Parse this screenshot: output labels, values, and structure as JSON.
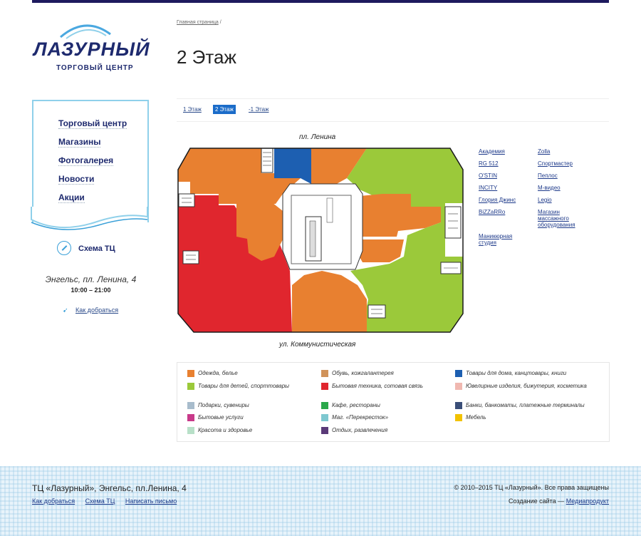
{
  "logo": {
    "name": "ЛАЗУРНЫЙ",
    "subtitle": "ТОРГОВЫЙ ЦЕНТР"
  },
  "nav": [
    {
      "label": "Торговый центр"
    },
    {
      "label": "Магазины"
    },
    {
      "label": "Фотогалерея"
    },
    {
      "label": "Новости"
    },
    {
      "label": "Акции"
    }
  ],
  "schema_label": "Схема ТЦ",
  "address": "Энгельс, пл. Ленина, 4",
  "hours": "10:00 – 21:00",
  "route_link": "Как добраться",
  "breadcrumb": {
    "home": "Главная страница",
    "sep": "/"
  },
  "page_title": "2 Этаж",
  "floor_tabs": [
    {
      "label": "1 Этаж",
      "active": false
    },
    {
      "label": "2 Этаж",
      "active": true
    },
    {
      "label": "-1 Этаж",
      "active": false
    }
  ],
  "map": {
    "street_top": "пл. Ленина",
    "street_bottom": "ул. Коммунистическая",
    "colors": {
      "orange": "#e88030",
      "red": "#e0262e",
      "green": "#9bc93a",
      "blue": "#1d5fb1",
      "center": "#ffffff",
      "wall": "#1a1a1a"
    }
  },
  "stores_col1": [
    "Академия",
    "RG 512",
    "O'STIN",
    "INCITY",
    "Глория Джинс",
    "BiZZaRRo",
    "Маникюрная студия"
  ],
  "stores_col2": [
    "Zolla",
    "Спортмастер",
    "Пеплос",
    "М-видео",
    "Legio",
    "Магазин массажного оборудования"
  ],
  "legend": [
    {
      "label": "Одежда, белье",
      "color": "#e88030"
    },
    {
      "label": "Обувь, кожгалантерея",
      "color": "#d0925a"
    },
    {
      "label": "Товары для дома, канцтовары, книги",
      "color": "#1d5fb1"
    },
    {
      "label": "Товары для детей, спорттовары",
      "color": "#9bc93a"
    },
    {
      "label": "Бытовая техника, сотовая связь",
      "color": "#e0262e"
    },
    {
      "label": "Ювелирные изделия, бижутерия, косметика",
      "color": "#f0b8b0"
    },
    {
      "label": "Подарки, сувениры",
      "color": "#a8bccc"
    },
    {
      "label": "Кафе, рестораны",
      "color": "#2aa84a"
    },
    {
      "label": "Банки, банкоматы, платежные терминалы",
      "color": "#3a4e78"
    },
    {
      "label": "Бытовые услуги",
      "color": "#c83a8a"
    },
    {
      "label": "Маг. «Перекресток»",
      "color": "#7ec8d0"
    },
    {
      "label": "Мебель",
      "color": "#f2c200"
    },
    {
      "label": "Красота и здоровье",
      "color": "#b8e0c8"
    },
    {
      "label": "Отдых, развлечения",
      "color": "#5a3a78"
    }
  ],
  "footer": {
    "title": "ТЦ «Лазурный», Энгельс, пл.Ленина, 4",
    "links": [
      "Как добраться",
      "Схема ТЦ",
      "Написать письмо"
    ],
    "copyright": "© 2010–2015 ТЦ «Лазурный». Все права защищены",
    "credit_prefix": "Создание сайта —",
    "credit_link": "Медиапродукт"
  }
}
